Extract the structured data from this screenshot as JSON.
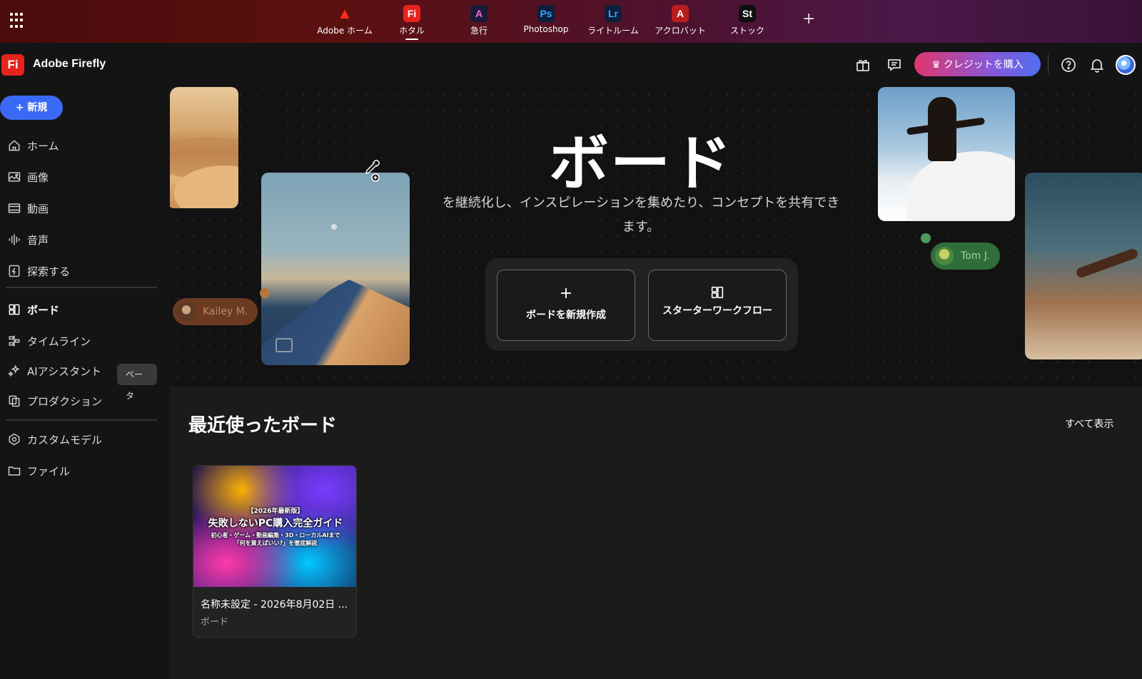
{
  "top_apps": [
    {
      "label": "Adobe ホーム",
      "icon": "adobe-logo-icon",
      "color": "#e8231d",
      "glyph": "A"
    },
    {
      "label": "ホタル",
      "icon": "firefly-app-icon",
      "color": "#e8231d",
      "glyph": "Fi"
    },
    {
      "label": "急行",
      "icon": "express-app-icon",
      "color": "#1b1b3a",
      "glyph": "A"
    },
    {
      "label": "Photoshop",
      "icon": "photoshop-app-icon",
      "color": "#0d1f3c",
      "glyph": "Ps"
    },
    {
      "label": "ライトルーム",
      "icon": "lightroom-app-icon",
      "color": "#0d1f3c",
      "glyph": "Lr"
    },
    {
      "label": "アクロバット",
      "icon": "acrobat-app-icon",
      "color": "#b81d1d",
      "glyph": "A"
    },
    {
      "label": "ストック",
      "icon": "stock-app-icon",
      "color": "#101010",
      "glyph": "St"
    }
  ],
  "header": {
    "logo_text": "Fi",
    "app_title": "Adobe Firefly",
    "buy_credits": "♛ クレジットを購入"
  },
  "sidebar": {
    "new_button": "+ 新規",
    "items": [
      {
        "label": "ホーム"
      },
      {
        "label": "画像"
      },
      {
        "label": "動画"
      },
      {
        "label": "音声"
      },
      {
        "label": "探索する"
      },
      {
        "label": "ボード"
      },
      {
        "label": "タイムライン"
      },
      {
        "label": "AIアシスタント",
        "badge": "ベータ"
      },
      {
        "label": "プロダクション"
      },
      {
        "label": "カスタムモデル"
      },
      {
        "label": "ファイル"
      }
    ]
  },
  "hero": {
    "title": "ボード",
    "description": "を継続化し、インスピレーションを集めたり、コンセプトを共有できます。",
    "create_board": "ボードを新規作成",
    "starter_workflow": "スターターワークフロー",
    "tag_kailey": "Kailey M.",
    "tag_tom": "Tom J."
  },
  "recent": {
    "title": "最近使ったボード",
    "show_all": "すべて表示",
    "cards": [
      {
        "thumb_line1": "【2026年最新版】",
        "thumb_line2": "失敗しないPC購入完全ガイド",
        "thumb_line3": "初心者・ゲーム・動画編集・3D・ローカルAIまで「何を買えばいい?」を徹底解説",
        "title": "名称未設定 - 2026年8月02日 ...",
        "type": "ボード"
      }
    ]
  }
}
